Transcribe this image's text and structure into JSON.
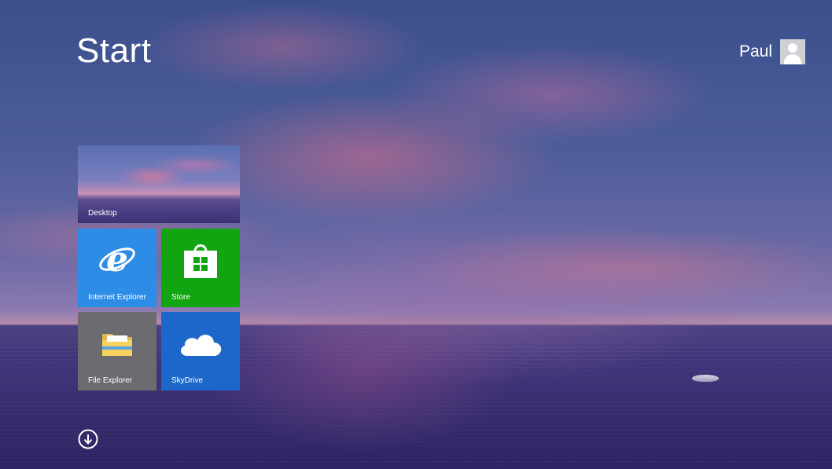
{
  "header": {
    "title": "Start",
    "user_name": "Paul"
  },
  "tiles": [
    {
      "label": "Desktop",
      "icon": "desktop-wallpaper-preview",
      "color": "#6b7bbb"
    },
    {
      "label": "Internet Explorer",
      "icon": "internet-explorer-icon",
      "color": "#2d8ce6"
    },
    {
      "label": "Store",
      "icon": "store-bag-icon",
      "color": "#11a511"
    },
    {
      "label": "File Explorer",
      "icon": "folder-icon",
      "color": "#6c6c70"
    },
    {
      "label": "SkyDrive",
      "icon": "cloud-icon",
      "color": "#1c67c9"
    }
  ],
  "footer": {
    "apps_button_icon": "down-arrow-circle-icon"
  },
  "colors": {
    "accent_background": "#3b4f8d",
    "text": "#ffffff"
  }
}
